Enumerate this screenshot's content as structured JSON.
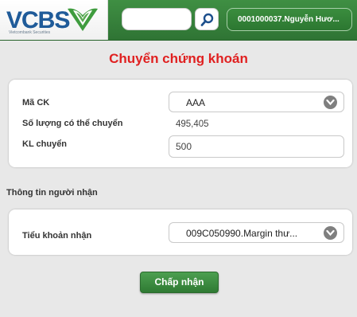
{
  "header": {
    "logo_text": "VCBS",
    "logo_subtext": "Vietcombank Securities",
    "search_value": "",
    "account_label": "0001000037.Nguyễn Hươ..."
  },
  "page": {
    "title": "Chuyển chứng khoán"
  },
  "transfer_form": {
    "stock_code_label": "Mã CK",
    "stock_code_value": "AAA",
    "available_qty_label": "Số lượng có thể chuyển",
    "available_qty_value": "495,405",
    "transfer_qty_label": "KL chuyển",
    "transfer_qty_value": "500"
  },
  "recipient": {
    "section_title": "Thông tin người nhận",
    "sub_account_label": "Tiểu khoản nhận",
    "sub_account_value": "009C050990.Margin thư..."
  },
  "actions": {
    "accept_label": "Chấp nhận"
  },
  "colors": {
    "brand_green": "#2f7434",
    "title_red": "#e02020",
    "logo_blue": "#1f5b99"
  }
}
